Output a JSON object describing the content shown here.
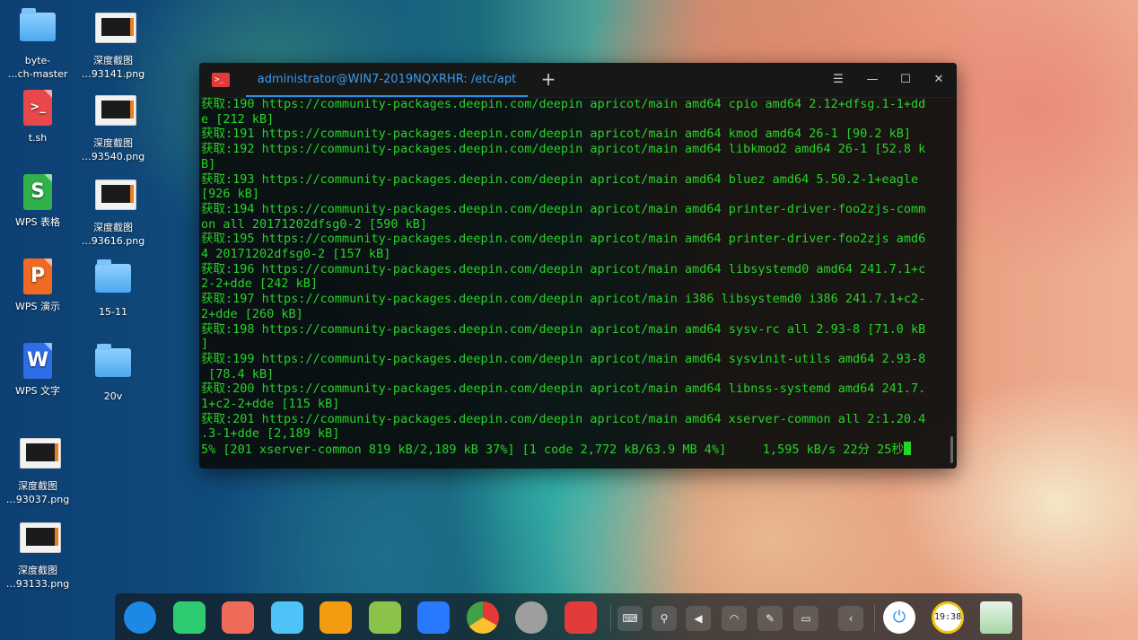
{
  "desktop": {
    "icons": [
      {
        "label": "byte-\n…ch-master",
        "kind": "folder"
      },
      {
        "label": "深度截图\n…93141.png",
        "kind": "thumb"
      },
      {
        "label": "t.sh",
        "kind": "shell",
        "glyph": ">_"
      },
      {
        "label": "深度截图\n…93540.png",
        "kind": "thumb"
      },
      {
        "label": "WPS 表格",
        "kind": "wps-sheet",
        "glyph": "S"
      },
      {
        "label": "深度截图\n…93616.png",
        "kind": "thumb"
      },
      {
        "label": "WPS 演示",
        "kind": "wps-slides",
        "glyph": "P"
      },
      {
        "label": "15-11",
        "kind": "folder"
      },
      {
        "label": "WPS 文字",
        "kind": "wps-writer",
        "glyph": "W"
      },
      {
        "label": "20v",
        "kind": "folder"
      },
      {
        "label": "深度截图\n…93037.png",
        "kind": "thumb"
      },
      {
        "label": "深度截图\n…93133.png",
        "kind": "thumb"
      }
    ]
  },
  "terminal": {
    "tab_title": "administrator@WIN7-2019NQXRHR: /etc/apt",
    "new_tab": "+",
    "menu": "☰",
    "minimize": "—",
    "maximize": "☐",
    "close": "✕",
    "lines": [
      "获取:190 https://community-packages.deepin.com/deepin apricot/main amd64 cpio amd64 2.12+dfsg.1-1+dd",
      "e [212 kB]",
      "获取:191 https://community-packages.deepin.com/deepin apricot/main amd64 kmod amd64 26-1 [90.2 kB]",
      "获取:192 https://community-packages.deepin.com/deepin apricot/main amd64 libkmod2 amd64 26-1 [52.8 k",
      "B]",
      "获取:193 https://community-packages.deepin.com/deepin apricot/main amd64 bluez amd64 5.50.2-1+eagle",
      "[926 kB]",
      "获取:194 https://community-packages.deepin.com/deepin apricot/main amd64 printer-driver-foo2zjs-comm",
      "on all 20171202dfsg0-2 [590 kB]",
      "获取:195 https://community-packages.deepin.com/deepin apricot/main amd64 printer-driver-foo2zjs amd6",
      "4 20171202dfsg0-2 [157 kB]",
      "获取:196 https://community-packages.deepin.com/deepin apricot/main amd64 libsystemd0 amd64 241.7.1+c",
      "2-2+dde [242 kB]",
      "获取:197 https://community-packages.deepin.com/deepin apricot/main i386 libsystemd0 i386 241.7.1+c2-",
      "2+dde [260 kB]",
      "获取:198 https://community-packages.deepin.com/deepin apricot/main amd64 sysv-rc all 2.93-8 [71.0 kB",
      "]",
      "获取:199 https://community-packages.deepin.com/deepin apricot/main amd64 sysvinit-utils amd64 2.93-8",
      " [78.4 kB]",
      "获取:200 https://community-packages.deepin.com/deepin apricot/main amd64 libnss-systemd amd64 241.7.",
      "1+c2-2+dde [115 kB]",
      "获取:201 https://community-packages.deepin.com/deepin apricot/main amd64 xserver-common all 2:1.20.4",
      ".3-1+dde [2,189 kB]",
      "5% [201 xserver-common 819 kB/2,189 kB 37%] [1 code 2,772 kB/63.9 MB 4%]     1,595 kB/s 22分 25秒"
    ]
  },
  "dock": {
    "apps": [
      {
        "name": "launcher",
        "color": "#1e88e5"
      },
      {
        "name": "file-manager",
        "color": "#2ecc71"
      },
      {
        "name": "screen-recorder",
        "color": "#f06a5a"
      },
      {
        "name": "app-store",
        "color": "#4fc3f7"
      },
      {
        "name": "deepin-store",
        "color": "#f39c12"
      },
      {
        "name": "music",
        "color": "#8bc34a"
      },
      {
        "name": "movie",
        "color": "#2979ff"
      },
      {
        "name": "chrome",
        "color": "#e53935"
      },
      {
        "name": "settings",
        "color": "#9e9e9e"
      },
      {
        "name": "terminal",
        "color": "#e23b3b"
      }
    ],
    "tray": [
      {
        "name": "keyboard",
        "glyph": "⌨"
      },
      {
        "name": "usb",
        "glyph": "⚲"
      },
      {
        "name": "volume",
        "glyph": "◀"
      },
      {
        "name": "wifi",
        "glyph": "◠"
      },
      {
        "name": "pen",
        "glyph": "✎"
      },
      {
        "name": "battery",
        "glyph": "▭"
      },
      {
        "name": "collapse",
        "glyph": "‹"
      }
    ],
    "clock": "19:38"
  }
}
